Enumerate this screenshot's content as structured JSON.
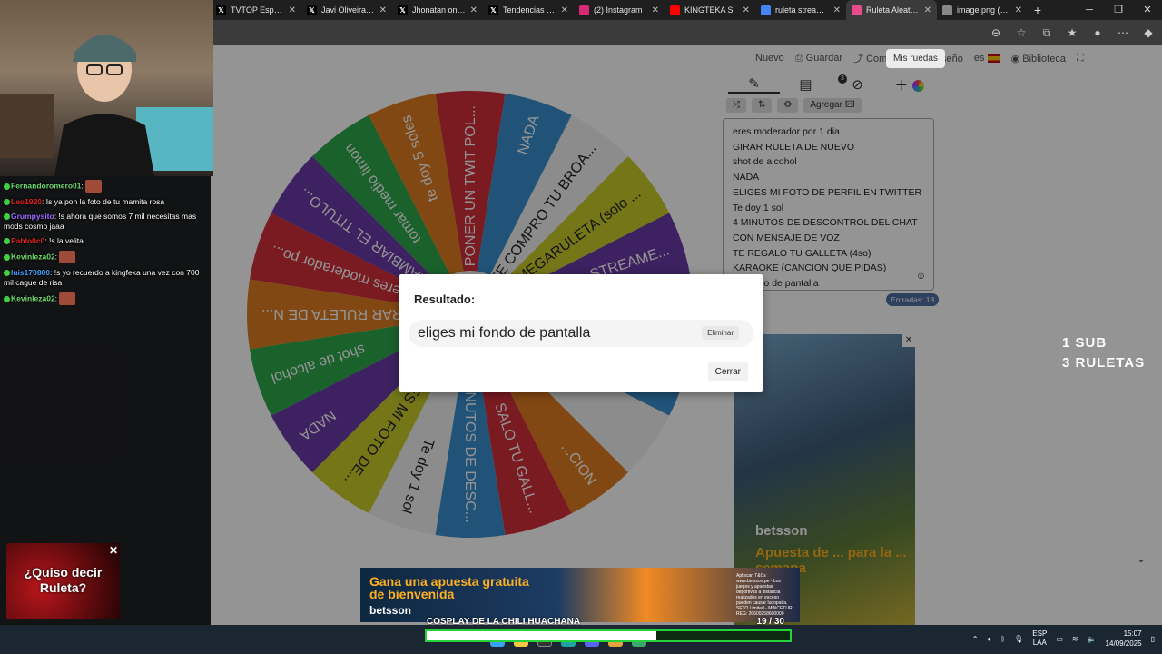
{
  "browser": {
    "tabs": [
      {
        "label": "TVTOP España o",
        "icon": "x-icon",
        "color": "#000000",
        "active": false
      },
      {
        "label": "Javi Oliveira (@j",
        "icon": "x-icon",
        "color": "#000000",
        "active": false
      },
      {
        "label": "Jhonatan on X: \"",
        "icon": "x-icon",
        "color": "#000000",
        "active": false
      },
      {
        "label": "Tendencias en A",
        "icon": "x-icon",
        "color": "#000000",
        "active": false
      },
      {
        "label": "(2) Instagram",
        "icon": "instagram-icon",
        "color": "#d62976",
        "active": false
      },
      {
        "label": "KINGTEKA S",
        "icon": "youtube-icon",
        "color": "#ff0000",
        "active": false
      },
      {
        "label": "ruleta streamer",
        "icon": "search-icon",
        "color": "#4285f4",
        "active": false
      },
      {
        "label": "Ruleta Aleatoria",
        "icon": "wheel-icon",
        "color": "#e84b8a",
        "active": true
      },
      {
        "label": "image.png (248",
        "icon": "globe-icon",
        "color": "#888888",
        "active": false
      }
    ]
  },
  "toolbar": {
    "nuevo": "Nuevo",
    "guardar": "Guardar",
    "compartir": "Compartir",
    "diseno": "Diseño",
    "lang": "es",
    "biblioteca": "Biblioteca",
    "mis_ruedas": "Mis ruedas"
  },
  "panel": {
    "agregar": "Agregar",
    "badge_count": "3",
    "entries": [
      "eres moderador por 1 dia",
      "GIRAR RULETA DE NUEVO",
      "shot de alcohol",
      "NADA",
      "ELIGES MI FOTO DE PERFIL EN TWITTER",
      "Te doy 1 sol",
      "4 MINUTOS DE DESCONTROL DEL CHAT",
      "CON MENSAJE DE VOZ",
      "TE REGALO TU GALLETA (4so)",
      "KARAOKE (CANCION QUE PIDAS)",
      "mi fondo de pantalla"
    ],
    "entries_count": "Entradas: 18"
  },
  "wheel": {
    "slices": [
      {
        "label": "PONER UN TWIT POL...",
        "color": "#d32f3a"
      },
      {
        "label": "NADA",
        "color": "#3a8fd0"
      },
      {
        "label": "TE COMPRO TU BROA...",
        "color": "#f1f1f1"
      },
      {
        "label": "MEGARULETA (solo ...",
        "color": "#c8cc2a"
      },
      {
        "label": "STREAME...",
        "color": "#6a3aa5"
      },
      {
        "label": "",
        "color": "#d32f3a"
      },
      {
        "label": "",
        "color": "#3a8fd0"
      },
      {
        "label": "",
        "color": "#f1f1f1"
      },
      {
        "label": "...CION",
        "color": "#e07d22"
      },
      {
        "label": "SALO TU GALL...",
        "color": "#d32f3a"
      },
      {
        "label": "MINUTOS DE DESC...",
        "color": "#3a8fd0"
      },
      {
        "label": "Te doy 1 sol",
        "color": "#f1f1f1"
      },
      {
        "label": "ELIGES MI FOTO DE...",
        "color": "#c8cc2a"
      },
      {
        "label": "NADA",
        "color": "#6a3aa5"
      },
      {
        "label": "shot de alcohol",
        "color": "#2ea84a"
      },
      {
        "label": "GIRAR RULETA DE N...",
        "color": "#e07d22"
      },
      {
        "label": "eres moderador po...",
        "color": "#d32f3a"
      },
      {
        "label": "...AMBIAR EL TITULO...",
        "color": "#6a3aa5"
      },
      {
        "label": "tomar medio limon",
        "color": "#2ea84a"
      },
      {
        "label": "te doy 5 soles",
        "color": "#e07d22"
      }
    ]
  },
  "modal": {
    "title": "Resultado:",
    "result": "eliges mi fondo de pantalla",
    "eliminar": "Eliminar",
    "cerrar": "Cerrar"
  },
  "overlay": {
    "line1": "1 SUB",
    "line2": "3 RULETAS"
  },
  "ads": {
    "right_brand": "betsson",
    "right_text": "Apuesta de ... para la ... semana",
    "bottom_headline": "Gana una apuesta gratuita de bienvenida",
    "bottom_brand": "betsson",
    "bottom_legal": "Apliscan T&Cs www.betsson.pe - Los juegos y apuestas deportivas a distancia realizados en exceso pueden causar ludopatía. SFTO Limited - MINCETUR REG: 20600258600000",
    "roulette_text": "¿Quiso decir Ruleta?"
  },
  "chat": [
    {
      "user": "Fernandoromero01",
      "color": "#6fd96f",
      "message": ":",
      "emote": true
    },
    {
      "user": "Leo1920",
      "color": "#e02424",
      "message": ": Is ya pon la foto de tu mamita rosa",
      "emote": false
    },
    {
      "user": "Grumpysito",
      "color": "#9d6bff",
      "message": ": !s ahora que somos 7 mil necesitas mas mods cosmo jaaa",
      "emote": false
    },
    {
      "user": "Pablo0c0",
      "color": "#e02424",
      "message": ": !s la velita",
      "emote": false
    },
    {
      "user": "Kevinleza02",
      "color": "#6fd96f",
      "message": ":",
      "emote": true
    },
    {
      "user": "luis170800",
      "color": "#3fa0ff",
      "message": ": !s yo recuerdo a kingfeka una vez con 700 mil cague de risa",
      "emote": false
    },
    {
      "user": "Kevinleza02",
      "color": "#6fd96f",
      "message": ":",
      "emote": true
    }
  ],
  "goal": {
    "title": "COSPLAY DE LA CHILI HUACHANA",
    "count": "19 / 30",
    "progress": 0.633
  },
  "taskbar": {
    "lang1": "ESP",
    "lang2": "LAA",
    "time": "15:07",
    "date": "14/09/2025"
  }
}
